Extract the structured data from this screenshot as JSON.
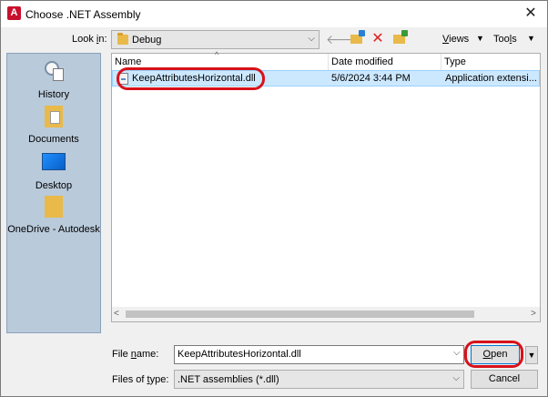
{
  "window": {
    "title": "Choose .NET Assembly",
    "app_icon": "A",
    "close": "✕"
  },
  "toolbar": {
    "lookin_label_pre": "Look ",
    "lookin_label_u": "i",
    "lookin_label_post": "n:",
    "lookin_value": "Debug",
    "views_pre": "",
    "views_u": "V",
    "views_post": "iews",
    "tools_pre": "Too",
    "tools_u": "l",
    "tools_post": "s"
  },
  "places": [
    {
      "label": "History"
    },
    {
      "label": "Documents"
    },
    {
      "label": "Desktop"
    },
    {
      "label": "OneDrive - Autodesk"
    }
  ],
  "filelist": {
    "columns": {
      "name": "Name",
      "date": "Date modified",
      "type": "Type"
    },
    "rows": [
      {
        "name": "KeepAttributesHorizontal.dll",
        "date": "5/6/2024 3:44 PM",
        "type": "Application extensi..."
      }
    ]
  },
  "footer": {
    "filename_label_pre": "File ",
    "filename_label_u": "n",
    "filename_label_post": "ame:",
    "filename_value": "KeepAttributesHorizontal.dll",
    "filetype_label_pre": "Files of ",
    "filetype_label_u": "t",
    "filetype_label_post": "ype:",
    "filetype_value": ".NET assemblies (*.dll)",
    "open_label_u": "O",
    "open_label_post": "pen",
    "cancel_label": "Cancel"
  },
  "colors": {
    "selection": "#cce8ff",
    "highlight": "#d8111a",
    "places_bg": "#b9cadb"
  }
}
